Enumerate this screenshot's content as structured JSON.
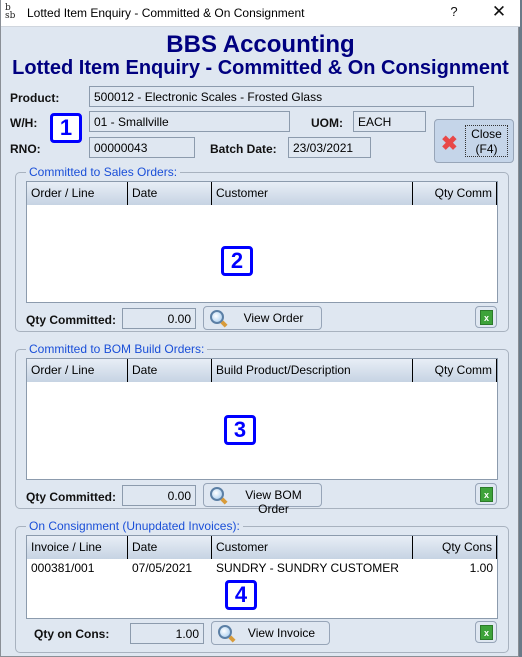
{
  "window": {
    "title": "Lotted Item Enquiry - Committed & On Consignment",
    "help_label": "?",
    "close_label": "✕",
    "app_icon": "bbs-logo-icon"
  },
  "header": {
    "title": "BBS Accounting",
    "subtitle": "Lotted Item Enquiry - Committed & On Consignment"
  },
  "form": {
    "product_label": "Product:",
    "product_value": "500012 - Electronic Scales - Frosted Glass",
    "wh_label": "W/H:",
    "wh_value": "01 - Smallville",
    "uom_label": "UOM:",
    "uom_value": "EACH",
    "rno_label": "RNO:",
    "rno_value": "00000043",
    "batch_date_label": "Batch Date:",
    "batch_date_value": "23/03/2021"
  },
  "close_button": {
    "line1": "Close",
    "line2": "(F4)",
    "icon": "close-x-icon"
  },
  "markers": [
    "1",
    "2",
    "3",
    "4"
  ],
  "sales_orders": {
    "title": "Committed to Sales Orders:",
    "columns": [
      "Order / Line",
      "Date",
      "Customer",
      "Qty Comm"
    ],
    "rows": [],
    "qty_label": "Qty Committed:",
    "qty_value": "0.00",
    "view_button": "View Order"
  },
  "bom_orders": {
    "title": "Committed to BOM Build Orders:",
    "columns": [
      "Order / Line",
      "Date",
      "Build Product/Description",
      "Qty Comm"
    ],
    "rows": [],
    "qty_label": "Qty Committed:",
    "qty_value": "0.00",
    "view_button": "View BOM Order"
  },
  "consignment": {
    "title": "On Consignment (Unupdated Invoices):",
    "columns": [
      "Invoice / Line",
      "Date",
      "Customer",
      "Qty Cons"
    ],
    "rows": [
      {
        "invoice_line": "000381/001",
        "date": "07/05/2021",
        "customer": "SUNDRY - SUNDRY CUSTOMER",
        "qty": "1.00"
      }
    ],
    "qty_label": "Qty on Cons:",
    "qty_value": "1.00",
    "view_button": "View Invoice"
  },
  "excel_icon_label": "x"
}
